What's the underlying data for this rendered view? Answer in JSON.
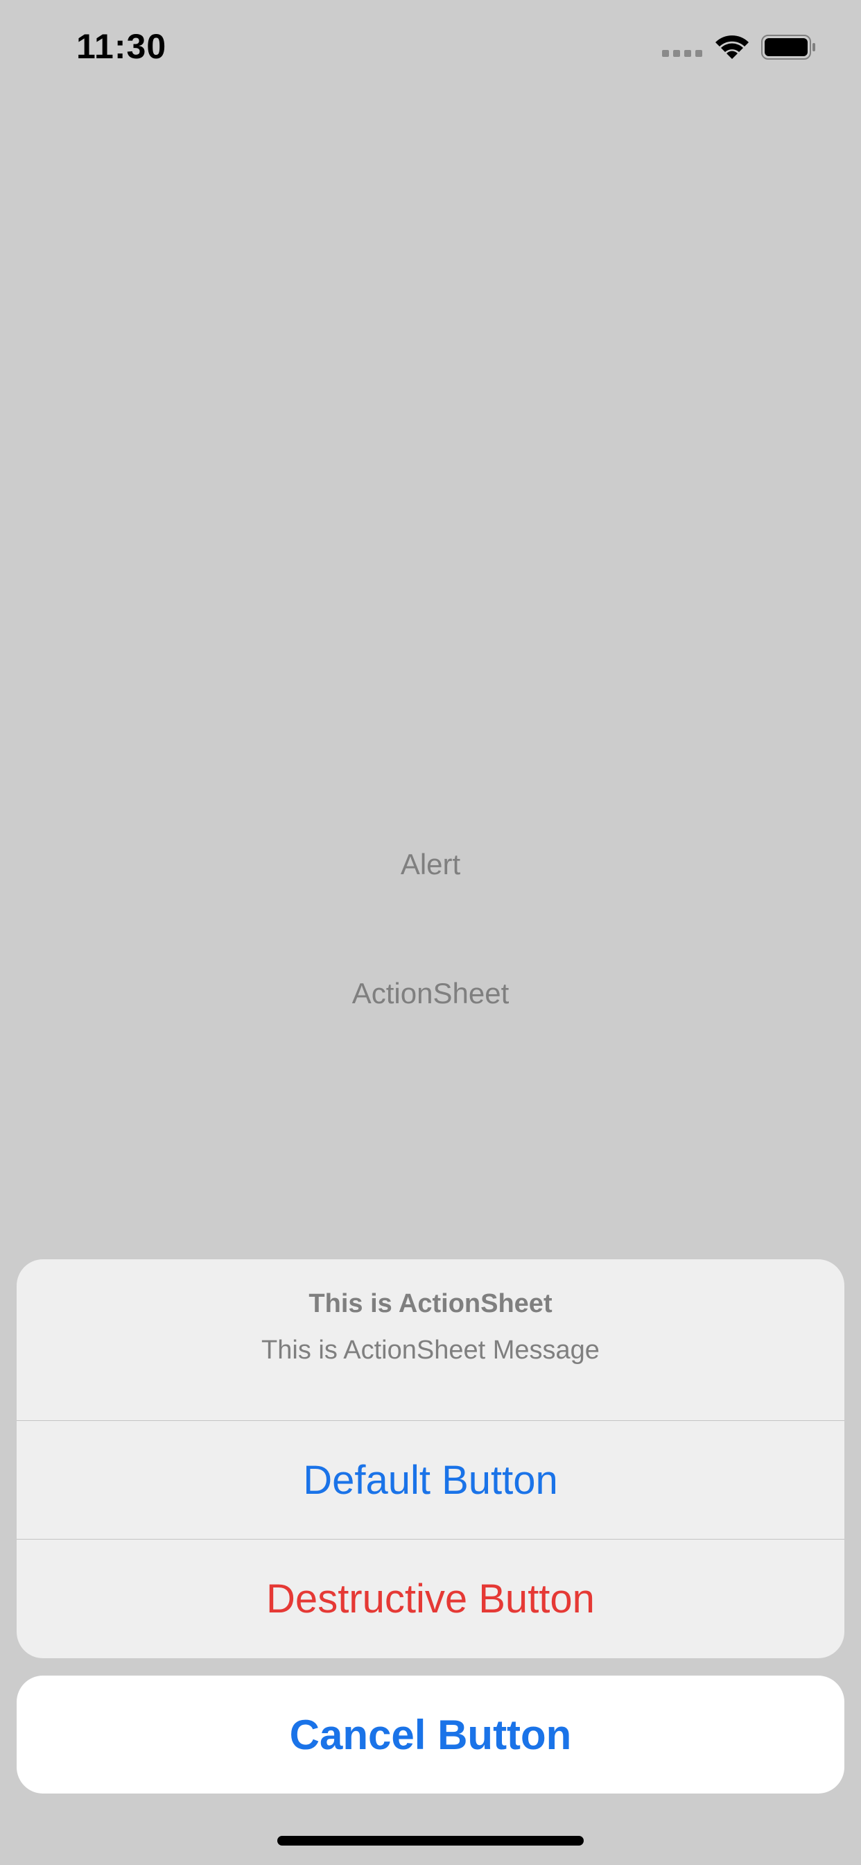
{
  "status_bar": {
    "time": "11:30",
    "icons": [
      "signal-icon",
      "wifi-icon",
      "battery-icon"
    ]
  },
  "screen": {
    "buttons": {
      "alert": "Alert",
      "action_sheet": "ActionSheet"
    }
  },
  "action_sheet": {
    "title": "This is ActionSheet",
    "message": "This is ActionSheet Message",
    "default_button": "Default Button",
    "destructive_button": "Destructive Button",
    "cancel_button": "Cancel Button"
  },
  "colors": {
    "background": "#cccccc",
    "sheet": "#efefef",
    "accent": "#1a73e8",
    "destructive": "#e53935"
  }
}
